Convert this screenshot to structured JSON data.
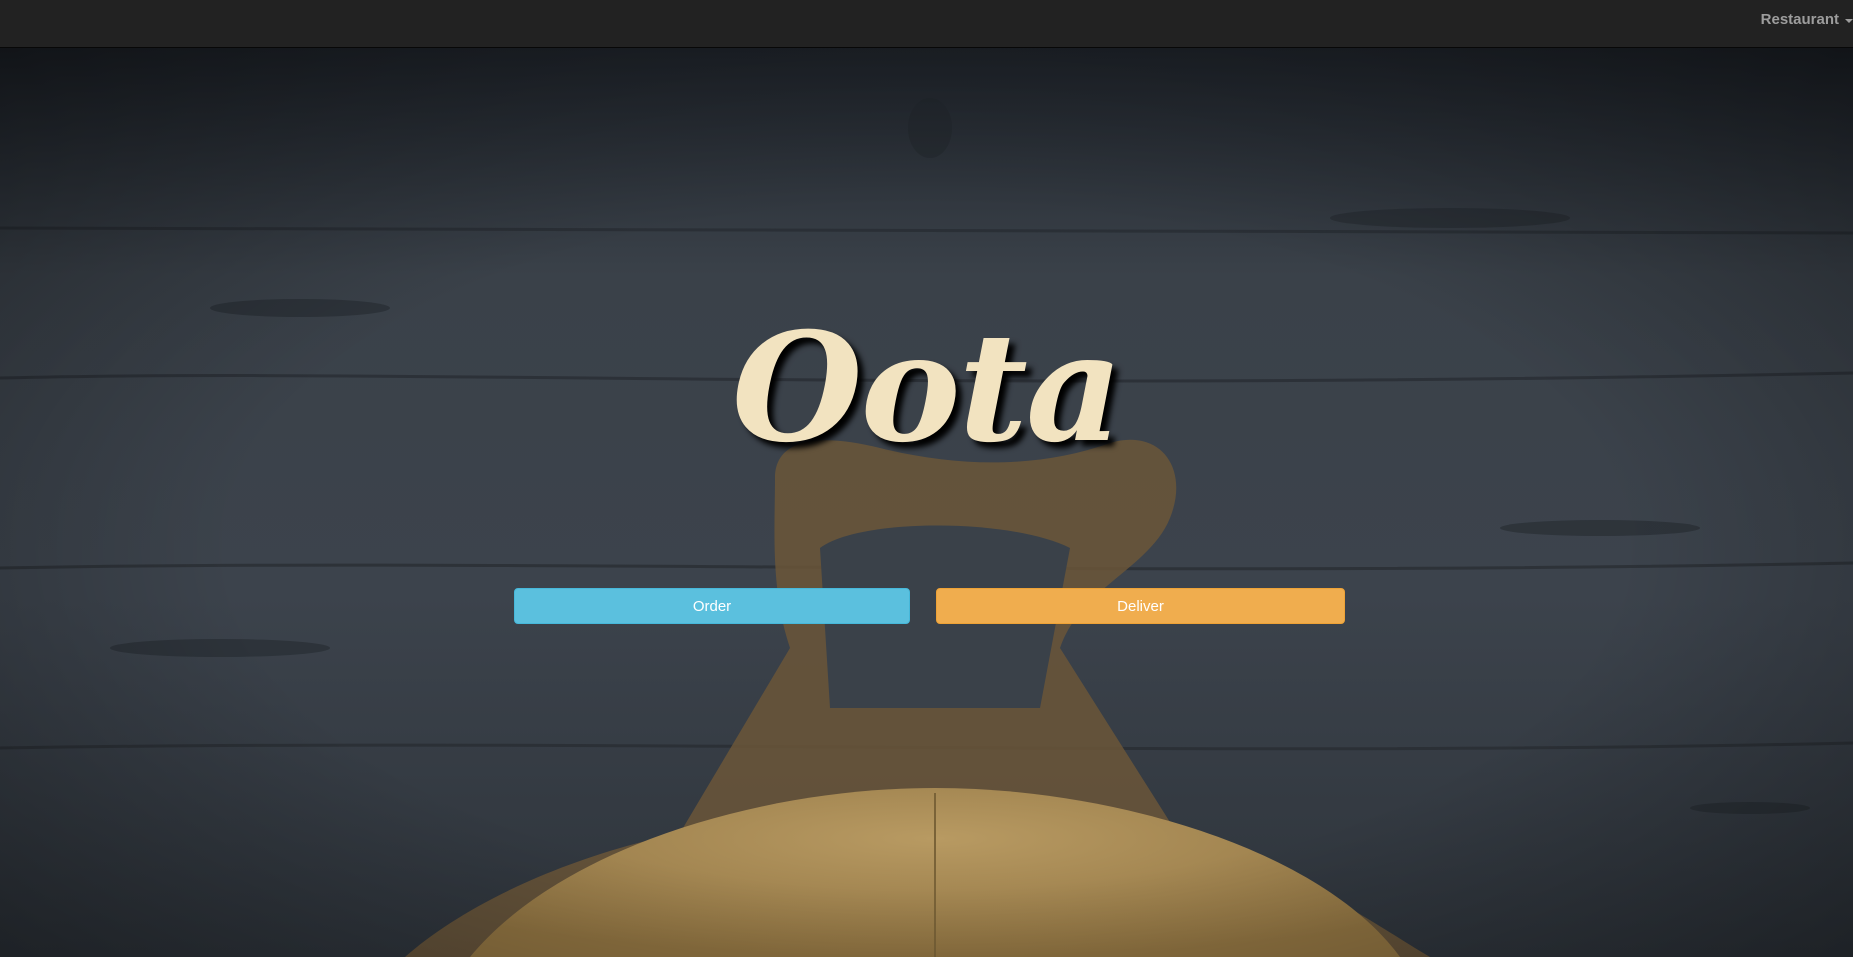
{
  "navbar": {
    "dropdown_label": "Restaurant",
    "dropdown_icon": "caret-down-icon"
  },
  "hero": {
    "title": "Oota",
    "background": "wooden-table-pizza-image",
    "buttons": {
      "order_label": "Order",
      "deliver_label": "Deliver"
    }
  },
  "colors": {
    "navbar_bg": "#222222",
    "nav_text": "#9d9d9d",
    "title_color": "#f2e3c0",
    "order_button": "#5bc0de",
    "deliver_button": "#f0ad4e"
  }
}
